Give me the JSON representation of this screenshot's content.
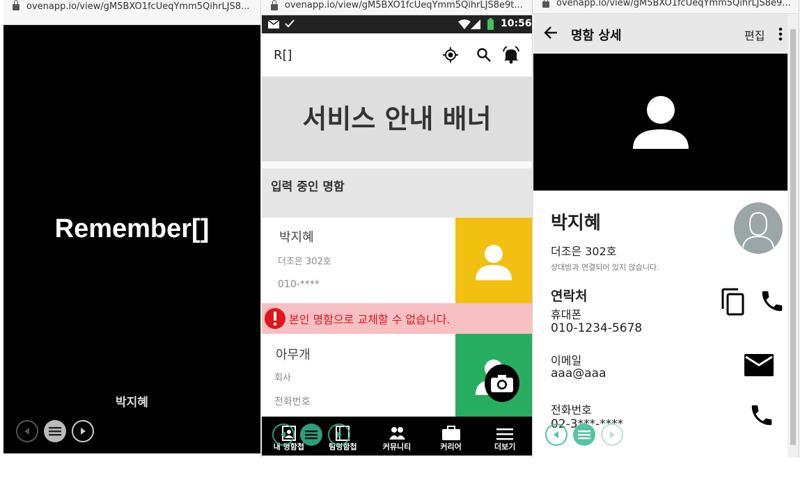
{
  "window1": {
    "url": "ovenapp.io/view/gM5BXO1fcUeqYmm5QihrLJS8...",
    "logo_text": "Remember[]",
    "owner_name": "박지혜"
  },
  "window2": {
    "url": "ovenapp.io/view/gM5BXO1fcUeqYmm5QihrLJS8e9t...",
    "time": "10:56",
    "app_title": "R[]",
    "banner_text": "서비스 안내 배너",
    "section_title": "입력 중인 명함",
    "cards": [
      {
        "name": "박지혜",
        "company": "더조은 302호",
        "phone": "010-****"
      },
      {
        "name": "아무개",
        "company": "회사",
        "phone": "전화번호"
      }
    ],
    "error_message": "본인 명함으로 교체할 수 없습니다.",
    "bottom_nav": [
      {
        "label": "내 명함첩",
        "icon": "card-book-icon"
      },
      {
        "label": "팀명함첩",
        "icon": "team-book-icon"
      },
      {
        "label": "커뮤니티",
        "icon": "community-icon"
      },
      {
        "label": "커리어",
        "icon": "briefcase-icon"
      },
      {
        "label": "더보기",
        "icon": "menu-icon"
      }
    ],
    "colors": {
      "card1_thumb": "#f2c010",
      "card2_thumb": "#27ae60"
    }
  },
  "window3": {
    "url": "ovenapp.io/view/gM5BXO1fcUeqYmm5QihrLJS8e9...",
    "title": "명함 상세",
    "edit_label": "편집",
    "name": "박지혜",
    "company": "더조은 302호",
    "connection_note": "상대방과 연결되어 있지 않습니다.",
    "contact_title": "연락처",
    "mobile_label": "휴대폰",
    "mobile_value": "010-1234-5678",
    "email_label": "이메일",
    "email_value": "aaa@aaa",
    "phone_label": "전화번호",
    "phone_value": "02-3***-****"
  }
}
